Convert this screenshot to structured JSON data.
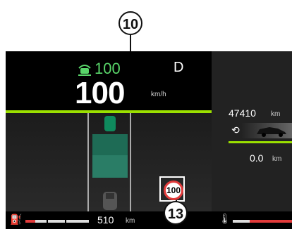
{
  "figure": {
    "id": "68367",
    "callout_top": "10",
    "callout_bottom": "13"
  },
  "dashboard": {
    "cruise_speed": "100",
    "gear": "D",
    "speed": "100",
    "speed_unit": "km/h",
    "traffic_sign_limit": "100",
    "fuel_range": "510",
    "range_unit": "km",
    "odometer": "47410",
    "odometer_unit": "km",
    "trip": "0.0",
    "trip_unit": "km",
    "colors": {
      "accent_green": "#59d66a",
      "bar_green": "#9be000",
      "warning_red": "#e23b3b"
    },
    "icons": {
      "cruise": "cruise-control-icon",
      "fuel": "fuel-pump-icon",
      "temperature": "coolant-temperature-icon",
      "trip_reset": "trip-cycle-icon"
    }
  }
}
